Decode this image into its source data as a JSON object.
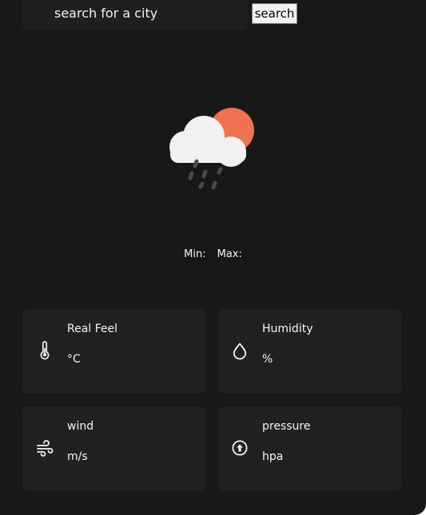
{
  "search": {
    "placeholder": "search for a city",
    "button_label": "search"
  },
  "weather": {
    "icon": "sun-behind-rain-cloud-icon",
    "min_label": "Min:",
    "max_label": "Max:"
  },
  "details": {
    "real_feel": {
      "title": "Real Feel",
      "value": "°C",
      "icon": "thermometer-icon"
    },
    "humidity": {
      "title": "Humidity",
      "value": "%",
      "icon": "droplet-icon"
    },
    "wind": {
      "title": "wind",
      "value": "m/s",
      "icon": "wind-icon"
    },
    "pressure": {
      "title": "pressure",
      "value": "hpa",
      "icon": "pressure-arrow-icon"
    }
  },
  "colors": {
    "background": "#181818",
    "card": "#212121",
    "text": "#f4f4f4",
    "sun": "#ee7350",
    "cloud": "#f1f1f1",
    "rain": "#4a4a4a"
  }
}
